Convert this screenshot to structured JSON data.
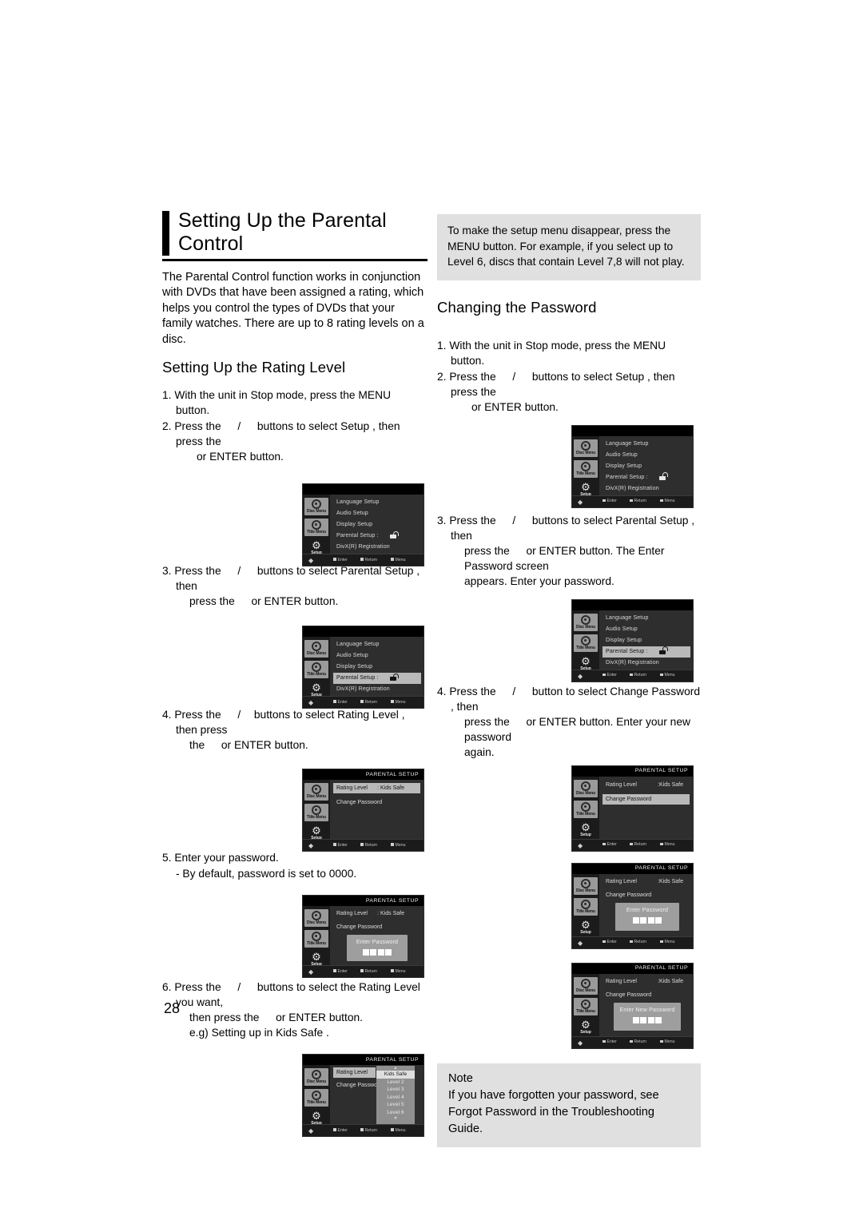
{
  "page": {
    "number": "28"
  },
  "left": {
    "title": "Setting Up the Parental Control",
    "intro": "The Parental Control function works in conjunction with DVDs that have been assigned a rating, which helps you control the types of DVDs that your family watches. There are up to 8 rating levels on a disc.",
    "section_heading": "Setting Up the Rating Level",
    "steps": [
      {
        "num": "1.",
        "text": "With the unit in Stop mode, press the MENU button."
      },
      {
        "num": "2.",
        "line1a": "Press the",
        "line1b": "/",
        "line1c": "buttons to select Setup , then press the",
        "line2": "or ENTER button."
      },
      {
        "num": "3.",
        "line1a": "Press the",
        "line1b": "/",
        "line1c": "buttons to select Parental Setup , then",
        "line2a": "press the",
        "line2b": "or ENTER button."
      },
      {
        "num": "4.",
        "line1a": "Press the",
        "line1b": "/",
        "line1c": "buttons to select Rating Level , then press",
        "line2a": "the",
        "line2b": "or ENTER button."
      },
      {
        "num": "5.",
        "text": "Enter your password.",
        "sub": "- By default, password is set to 0000."
      },
      {
        "num": "6.",
        "line1a": "Press the",
        "line1b": "/",
        "line1c": "buttons to select the Rating Level you want,",
        "line2a": "then press the",
        "line2b": "or ENTER button.",
        "line3": "e.g) Setting up in Kids Safe ."
      }
    ]
  },
  "right": {
    "infobox": "To make the setup menu disappear, press the MENU button. For example, if you select up to Level 6, discs that contain Level 7,8 will not play.",
    "section_heading": "Changing the Password",
    "steps": [
      {
        "num": "1.",
        "text": "With the unit in Stop mode, press the MENU button."
      },
      {
        "num": "2.",
        "line1a": "Press the",
        "line1b": "/",
        "line1c": "buttons to select Setup , then press the",
        "line2": "or ENTER button."
      },
      {
        "num": "3.",
        "line1a": "Press the",
        "line1b": "/",
        "line1c": "buttons to select Parental Setup , then",
        "line2a": "press the",
        "line2b": "or ENTER button. The Enter Password screen",
        "line3": "appears. Enter your password."
      },
      {
        "num": "4.",
        "line1a": "Press the",
        "line1b": "/",
        "line1c": "button to select Change Password , then",
        "line2a": "press the",
        "line2b": "or ENTER button. Enter your new password",
        "line3": "again."
      }
    ],
    "note": {
      "title": "Note",
      "line1": "If you have forgotten your password, see",
      "line2": " Forgot Password  in the Troubleshooting Guide."
    }
  },
  "osd": {
    "rail": {
      "disc_menu": "Disc Menu",
      "title_menu": "Title Menu",
      "setup": "Setup"
    },
    "footer": {
      "enter": "Enter",
      "return": "Return",
      "menu": "Menu"
    },
    "setup_menu": {
      "items": [
        "Language Setup",
        "Audio Setup",
        "Display Setup",
        "Parental Setup :",
        "DivX(R) Registration"
      ]
    },
    "parental": {
      "title": "PARENTAL SETUP",
      "rating_label": "Rating Level",
      "rating_value": ": Kids Safe",
      "rating_value_tight": ":Kids Safe",
      "change_password": "Change Password",
      "change_password_trunc": "Change Passwor"
    },
    "password": {
      "enter": "Enter Password",
      "enter_new": "Enter New Password"
    },
    "rating_dropdown": {
      "up_arrow": "▲",
      "down_arrow": "▼",
      "items": [
        "Kids Safe",
        "Level 2",
        "Level 3",
        "Level 4",
        "Level 5",
        "Level 6"
      ]
    }
  },
  "colors": {
    "infobox_bg": "#e0e0e0",
    "osd_bg": "#2e2e2e",
    "osd_titlebar": "#000000",
    "osd_highlight": "#b9b9b9"
  }
}
